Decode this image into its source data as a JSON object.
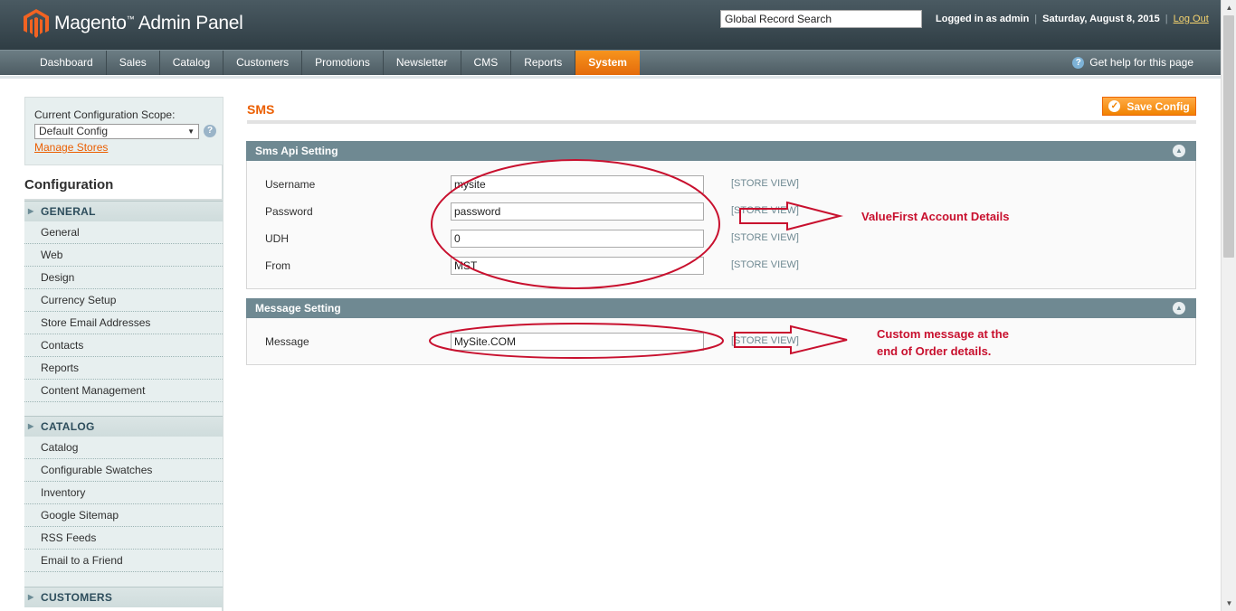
{
  "header": {
    "brand": "Magento",
    "brand_suffix": "Admin Panel",
    "search_value": "Global Record Search",
    "logged_in": "Logged in as admin",
    "date": "Saturday, August 8, 2015",
    "logout": "Log Out"
  },
  "nav": {
    "items": [
      "Dashboard",
      "Sales",
      "Catalog",
      "Customers",
      "Promotions",
      "Newsletter",
      "CMS",
      "Reports",
      "System"
    ],
    "active": "System",
    "help": "Get help for this page"
  },
  "scope": {
    "label": "Current Configuration Scope:",
    "selected": "Default Config",
    "manage_stores": "Manage Stores"
  },
  "sidebar": {
    "title": "Configuration",
    "groups": [
      {
        "label": "GENERAL",
        "items": [
          "General",
          "Web",
          "Design",
          "Currency Setup",
          "Store Email Addresses",
          "Contacts",
          "Reports",
          "Content Management"
        ]
      },
      {
        "label": "CATALOG",
        "items": [
          "Catalog",
          "Configurable Swatches",
          "Inventory",
          "Google Sitemap",
          "RSS Feeds",
          "Email to a Friend"
        ]
      },
      {
        "label": "CUSTOMERS",
        "items": []
      }
    ]
  },
  "main": {
    "title": "SMS",
    "save_label": "Save Config",
    "sections": [
      {
        "title": "Sms Api Setting",
        "fields": [
          {
            "label": "Username",
            "value": "mysite",
            "scope": "[STORE VIEW]"
          },
          {
            "label": "Password",
            "value": "password",
            "scope": "[STORE VIEW]"
          },
          {
            "label": "UDH",
            "value": "0",
            "scope": "[STORE VIEW]"
          },
          {
            "label": "From",
            "value": "MST",
            "scope": "[STORE VIEW]"
          }
        ]
      },
      {
        "title": "Message Setting",
        "fields": [
          {
            "label": "Message",
            "value": "MySite.COM",
            "scope": "[STORE VIEW]"
          }
        ]
      }
    ]
  },
  "annotations": {
    "account": "ValueFirst Account Details",
    "message_line1": "Custom message at the",
    "message_line2": "end of Order details.",
    "color": "#c8102e"
  },
  "colors": {
    "accent": "#eb5e00",
    "header": "#2f3d44",
    "section_head": "#6f8992"
  }
}
